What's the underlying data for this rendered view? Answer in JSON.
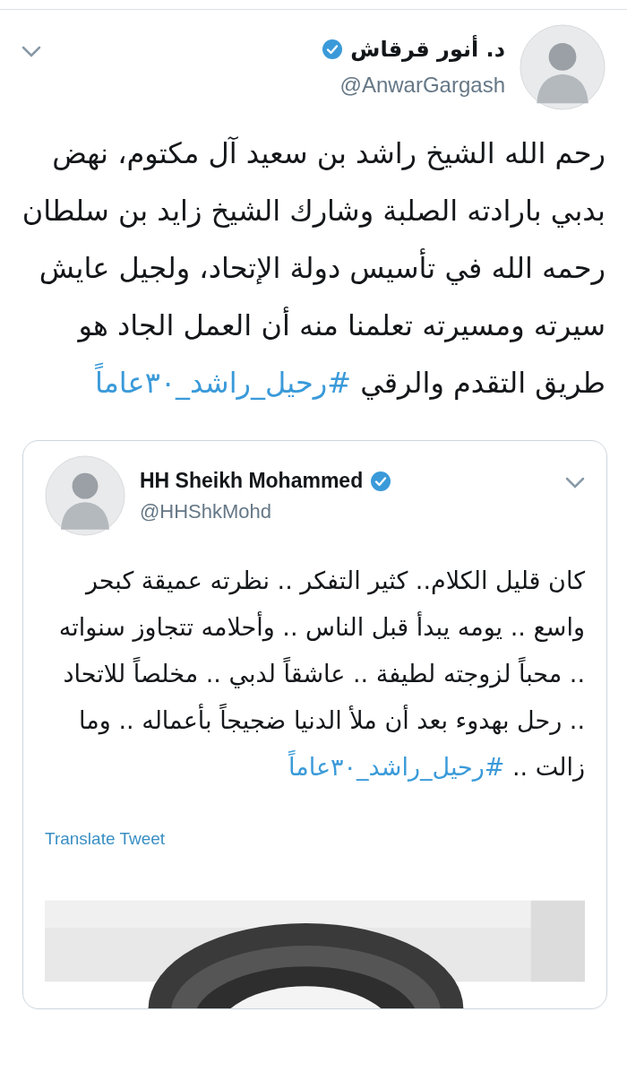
{
  "tweet": {
    "author": {
      "name": "د. أنور قرقاش",
      "handle": "@AnwarGargash",
      "verified": true
    },
    "text": "رحم الله الشيخ راشد بن سعيد آل مكتوم، نهض بدبي بارادته الصلبة وشارك الشيخ زايد بن سلطان رحمه الله في تأسيس دولة الإتحاد، ولجيل عايش سيرته ومسيرته تعلمنا منه أن العمل الجاد هو طريق التقدم والرقي",
    "hashtag": "#رحيل_راشد_٣٠عاماً",
    "quoted_tweet": {
      "author": {
        "name": "HH Sheikh Mohammed",
        "handle": "@HHShkMohd",
        "verified": true
      },
      "text": "كان قليل الكلام.. كثير التفكر .. نظرته عميقة كبحر واسع .. يومه يبدأ قبل الناس .. وأحلامه تتجاوز سنواته .. محباً لزوجته لطيفة .. عاشقاً لدبي .. مخلصاً للاتحاد .. رحل بهدوء بعد أن ملأ الدنيا ضجيجاً بأعماله .. وما زالت ..",
      "hashtag": "#رحيل_راشد_٣٠عاماً",
      "translate_link": "Translate Tweet"
    }
  }
}
